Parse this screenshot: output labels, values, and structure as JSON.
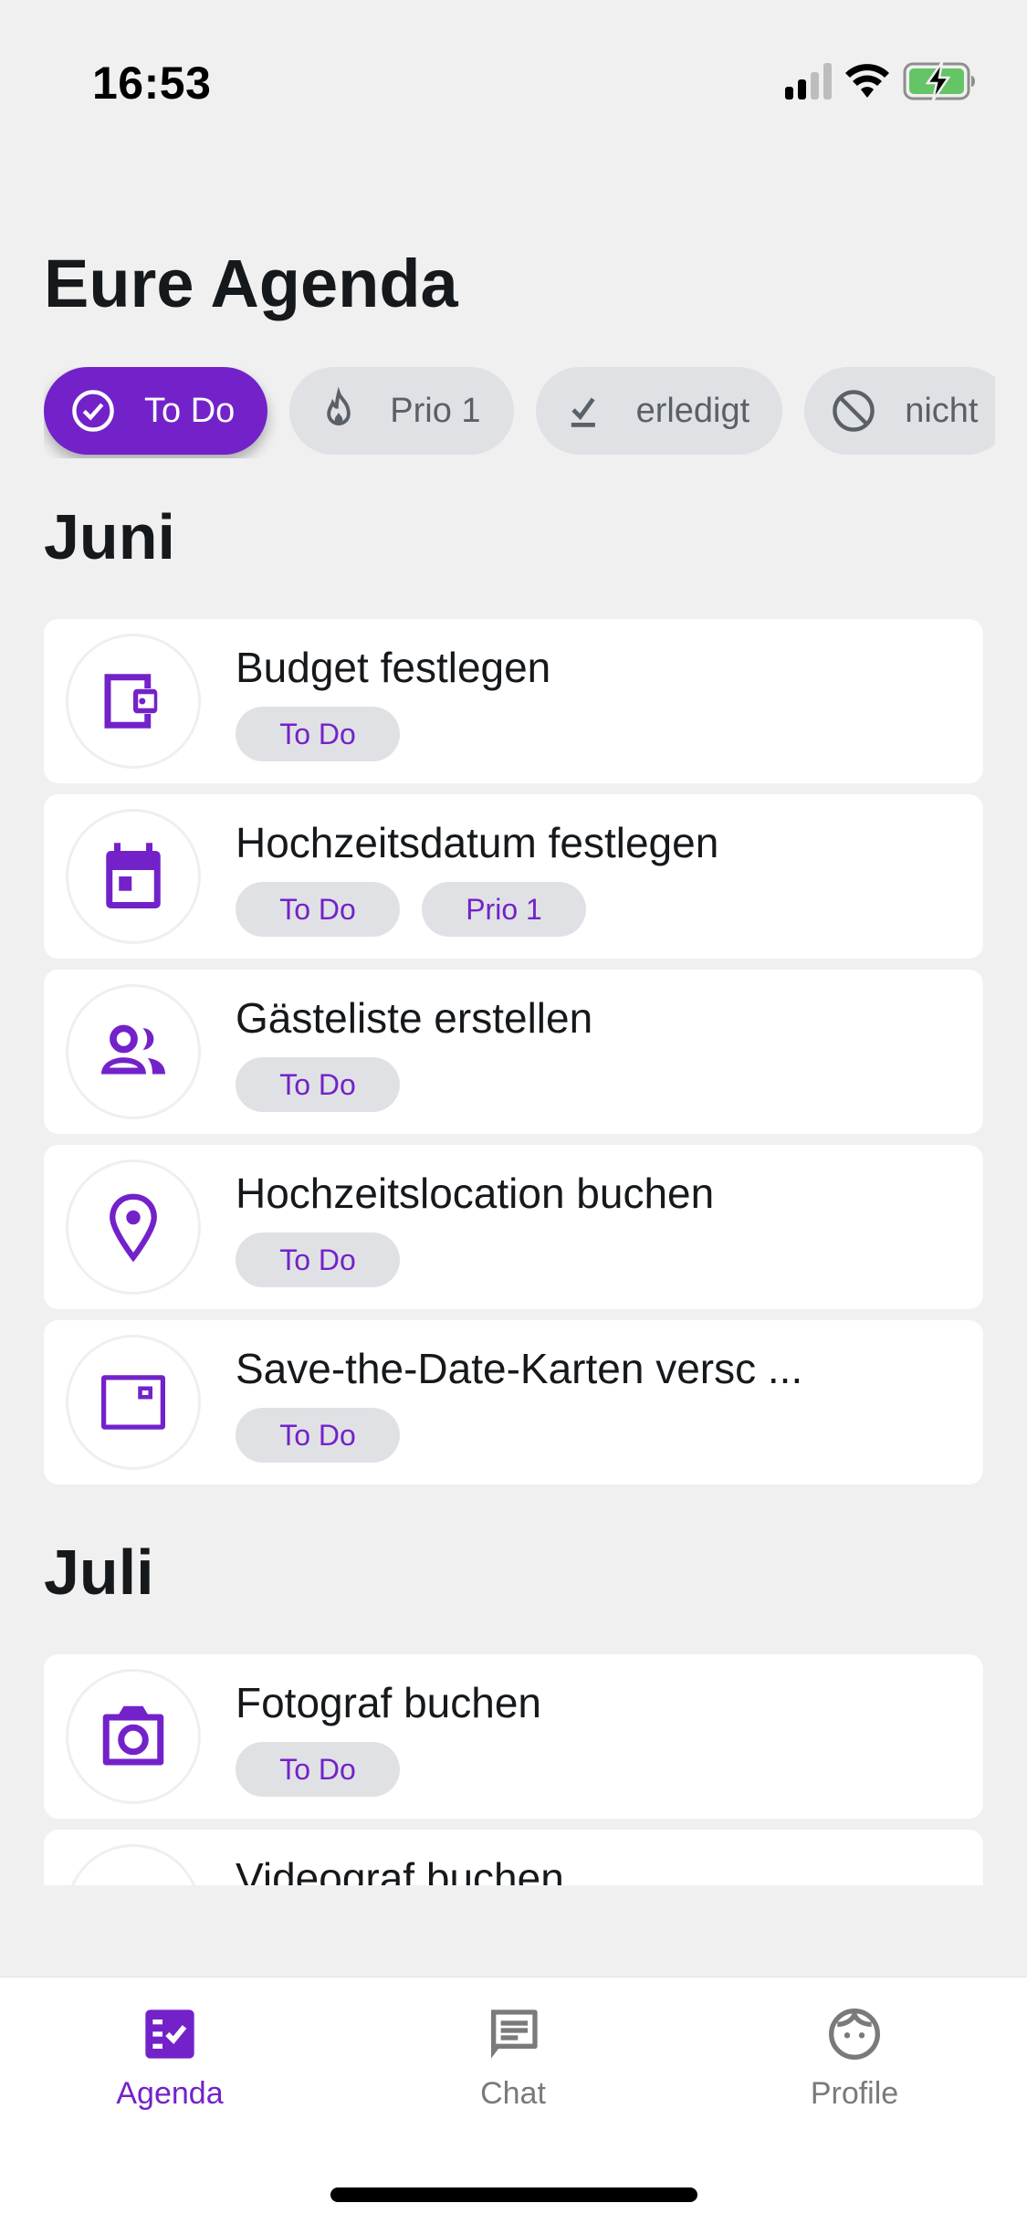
{
  "status_bar": {
    "time": "16:53",
    "icons": [
      "cellular-signal-icon",
      "wifi-icon",
      "battery-charging-icon"
    ]
  },
  "header": {
    "title": "Eure Agenda"
  },
  "filters": [
    {
      "label": "To Do",
      "icon": "check-circle-icon",
      "active": true
    },
    {
      "label": "Prio 1",
      "icon": "flame-icon",
      "active": false
    },
    {
      "label": "erledigt",
      "icon": "done-icon",
      "active": false
    },
    {
      "label": "nicht",
      "icon": "block-icon",
      "active": false
    }
  ],
  "sections": [
    {
      "title": "Juni",
      "tasks": [
        {
          "title": "Budget festlegen",
          "icon": "wallet-icon",
          "tags": [
            "To Do"
          ]
        },
        {
          "title": "Hochzeitsdatum festlegen",
          "icon": "calendar-icon",
          "tags": [
            "To Do",
            "Prio 1"
          ]
        },
        {
          "title": "Gästeliste erstellen",
          "icon": "people-icon",
          "tags": [
            "To Do"
          ]
        },
        {
          "title": "Hochzeitslocation buchen",
          "icon": "location-pin-icon",
          "tags": [
            "To Do"
          ]
        },
        {
          "title": "Save-the-Date-Karten versc ...",
          "icon": "postcard-icon",
          "tags": [
            "To Do"
          ]
        }
      ]
    },
    {
      "title": "Juli",
      "tasks": [
        {
          "title": "Fotograf buchen",
          "icon": "camera-icon",
          "tags": [
            "To Do"
          ]
        },
        {
          "title": "Videograf buchen",
          "icon": "video-icon",
          "tags": []
        }
      ]
    }
  ],
  "tab_bar": {
    "items": [
      {
        "label": "Agenda",
        "icon": "agenda-checklist-icon",
        "active": true
      },
      {
        "label": "Chat",
        "icon": "chat-bubble-icon",
        "active": false
      },
      {
        "label": "Profile",
        "icon": "face-icon",
        "active": false
      }
    ]
  },
  "colors": {
    "accent": "#7322ca",
    "background": "#f0f0f0",
    "chip_inactive_bg": "#e0e1e5",
    "chip_inactive_text": "#5a6068",
    "card_bg": "#ffffff",
    "text_primary": "#16191c",
    "tab_inactive": "#7a7a7a"
  }
}
